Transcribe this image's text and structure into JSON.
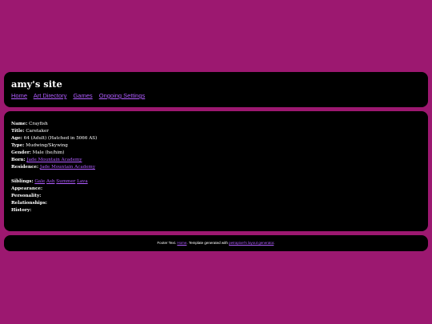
{
  "header": {
    "title": "amy's site",
    "nav": [
      "Home",
      "Art Directory",
      "Games",
      "Ongoing Settings"
    ]
  },
  "profile": {
    "name_label": "Name:",
    "name": "Crayfish",
    "title_label": "Title:",
    "title": "Caretaker",
    "age_label": "Age:",
    "age": "64 (Adult) (Hatched in 5066 AS)",
    "type_label": "Type:",
    "type": "Mudwing/Skywing",
    "gender_label": "Gender:",
    "gender": "Male (he/him)",
    "born_label": "Born:",
    "born": "Jade Mountain Academy",
    "residence_label": "Residence:",
    "residence": "Jade Mountain Academy",
    "siblings_label": "Siblings:",
    "siblings": [
      "Gale",
      "Ash",
      "Summer",
      "Lava"
    ],
    "appearance_label": "Appearance:",
    "personality_label": "Personality:",
    "relationships_label": "Relationships:",
    "history_label": "History:"
  },
  "footer": {
    "prefix": "Footer Text.",
    "home_link": "Home",
    "middle": ". Template generated with",
    "generator_link": "petrapixel's layout generator",
    "suffix": "."
  },
  "colors": {
    "background": "#9c1870",
    "panel": "#000000",
    "link": "#b05cff",
    "text": "#ffffff"
  }
}
